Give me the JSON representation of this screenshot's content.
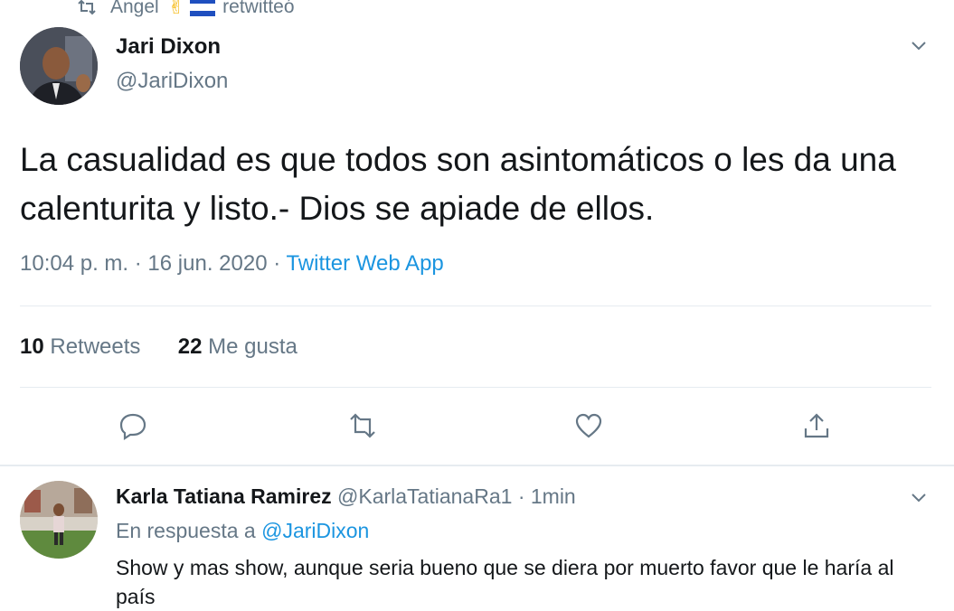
{
  "retweet_header": {
    "user": "Angel",
    "suffix": "retwitteó",
    "emoji": "victory-hand"
  },
  "tweet": {
    "author_name": "Jari Dixon",
    "author_handle": "@JariDixon",
    "text": "La casualidad es que todos son asintomáticos o les da una calenturita y listo.- Dios se apiade de ellos.",
    "time": "10:04 p. m.",
    "dot1": "·",
    "date": "16 jun. 2020",
    "dot2": "·",
    "source": "Twitter Web App",
    "retweets_count": "10",
    "retweets_label": "Retweets",
    "likes_count": "22",
    "likes_label": "Me gusta"
  },
  "reply": {
    "author_name": "Karla Tatiana Ramirez",
    "author_handle": "@KarlaTatianaRa1",
    "dot": "·",
    "time": "1min",
    "in_reply_prefix": "En respuesta a",
    "in_reply_handle": "@JariDixon",
    "text": "Show y mas show, aunque seria bueno que se diera por muerto favor que le haría al país"
  },
  "icons": [
    "retweet-icon",
    "chevron-down-icon",
    "reply-icon",
    "like-icon",
    "share-icon"
  ],
  "colors": {
    "accent": "#1b95e0",
    "secondary_text": "#657786",
    "divider": "#e6ecf0"
  }
}
